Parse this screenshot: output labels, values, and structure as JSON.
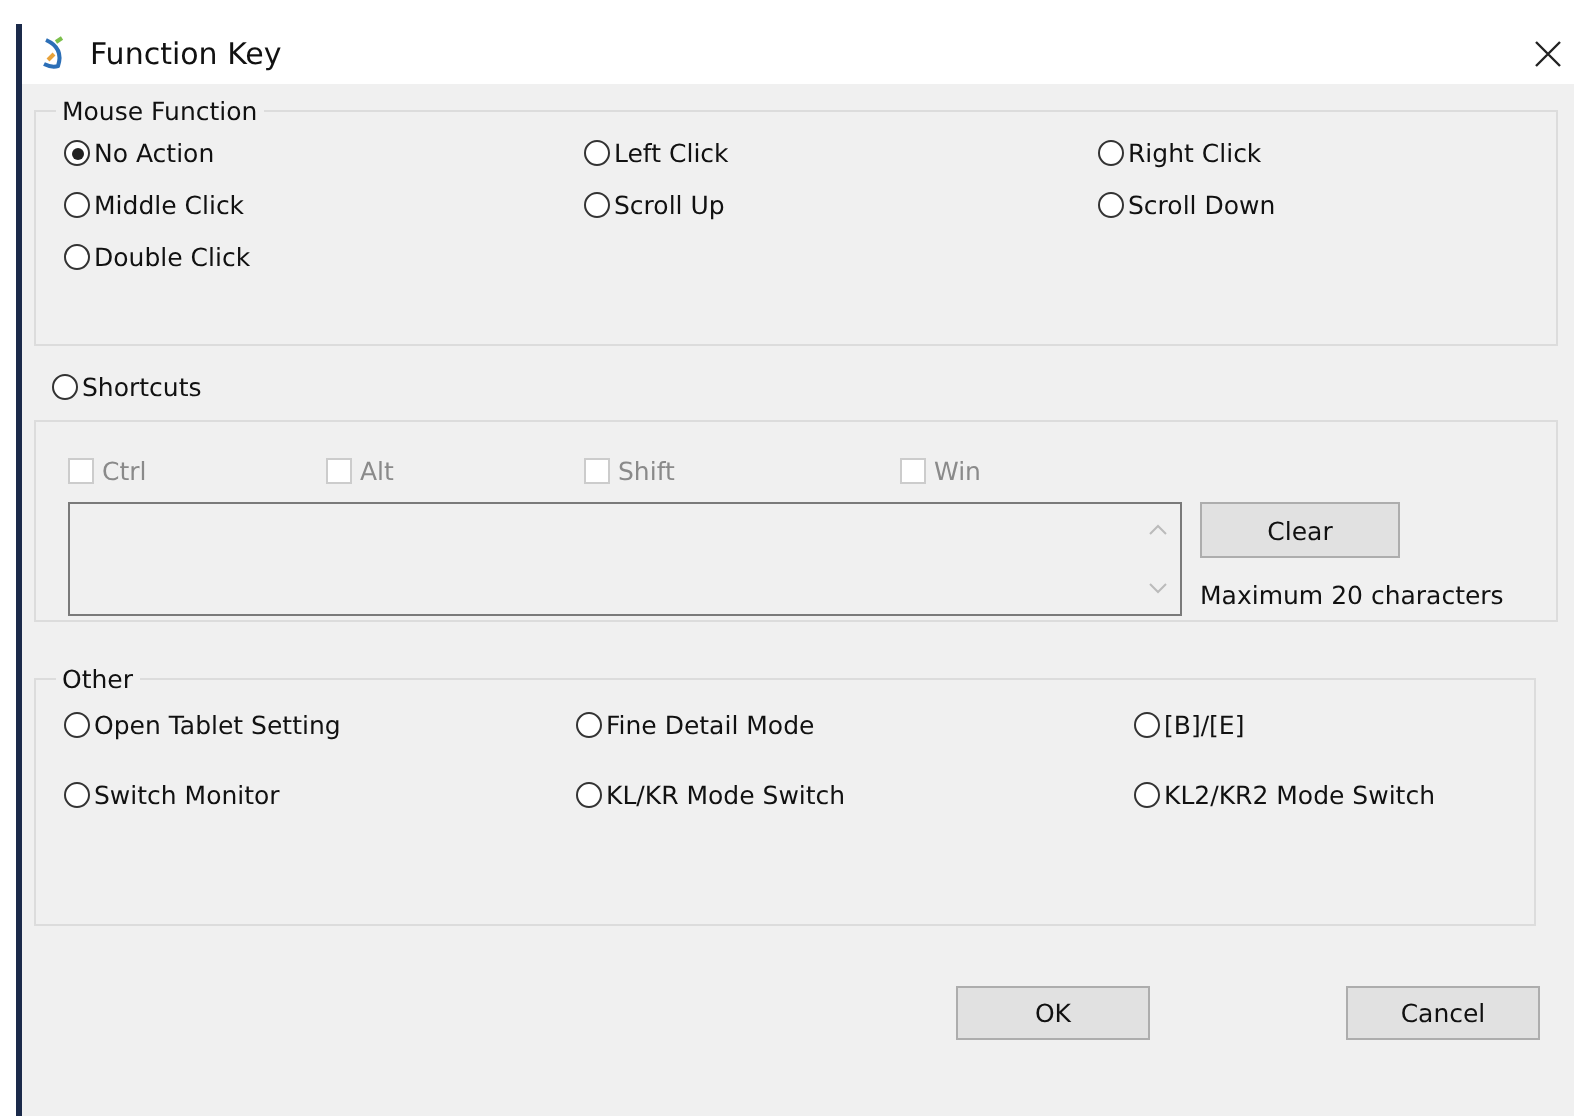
{
  "window": {
    "title": "Function Key"
  },
  "mouse_function": {
    "label": "Mouse Function",
    "options": [
      {
        "label": "No Action",
        "selected": true
      },
      {
        "label": "Left Click",
        "selected": false
      },
      {
        "label": "Right Click",
        "selected": false
      },
      {
        "label": "Middle Click",
        "selected": false
      },
      {
        "label": "Scroll Up",
        "selected": false
      },
      {
        "label": "Scroll Down",
        "selected": false
      },
      {
        "label": "Double Click",
        "selected": false
      }
    ]
  },
  "shortcuts": {
    "label": "Shortcuts",
    "selected": false,
    "modifiers": [
      {
        "label": "Ctrl",
        "checked": false,
        "disabled": true
      },
      {
        "label": "Alt",
        "checked": false,
        "disabled": true
      },
      {
        "label": "Shift",
        "checked": false,
        "disabled": true
      },
      {
        "label": "Win",
        "checked": false,
        "disabled": true
      }
    ],
    "clear_button": "Clear",
    "hint": "Maximum 20 characters"
  },
  "other": {
    "label": "Other",
    "options": [
      {
        "label": "Open Tablet Setting",
        "selected": false
      },
      {
        "label": "Fine Detail Mode",
        "selected": false
      },
      {
        "label": "[B]/[E]",
        "selected": false
      },
      {
        "label": "Switch Monitor",
        "selected": false
      },
      {
        "label": "KL/KR Mode Switch",
        "selected": false
      },
      {
        "label": "KL2/KR2 Mode Switch",
        "selected": false
      }
    ]
  },
  "buttons": [
    "OK",
    "Cancel"
  ]
}
